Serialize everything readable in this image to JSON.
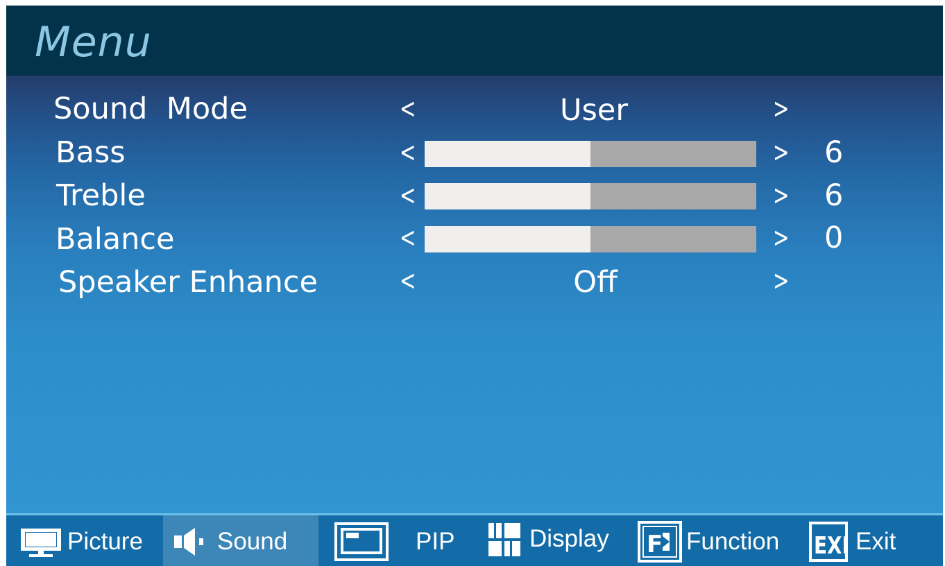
{
  "menu": {
    "title": "Menu"
  },
  "sound_mode": {
    "label": "Sound  Mode",
    "value": "User"
  },
  "bass": {
    "label": "Bass",
    "value": "6",
    "level_percent": 50
  },
  "treble": {
    "label": "Treble",
    "value": "6",
    "level_percent": 50
  },
  "balance": {
    "label": "Balance",
    "value": "0",
    "level_percent": 50
  },
  "speaker_enhance": {
    "label": "Speaker Enhance",
    "value": "Off"
  },
  "arrows": {
    "left": "<",
    "right": ">"
  },
  "tabs": [
    {
      "label": "Picture",
      "icon": "monitor-icon",
      "active": false
    },
    {
      "label": "Sound",
      "icon": "speaker-icon",
      "active": true
    },
    {
      "label": "PIP",
      "icon": "pip-window-icon",
      "active": false
    },
    {
      "label": "Display",
      "icon": "grid-icon",
      "active": false
    },
    {
      "label": "Function",
      "icon": "function-icon",
      "active": false
    },
    {
      "label": "Exit",
      "icon": "exit-icon",
      "active": false
    }
  ],
  "colors": {
    "title_bar": "#03334a",
    "title_text": "#8ec7e4",
    "bottom_bar": "#136ca7",
    "active_tab": "#3d86b8",
    "slider_fill": "#f0efee",
    "slider_track": "#a8a8a8"
  }
}
